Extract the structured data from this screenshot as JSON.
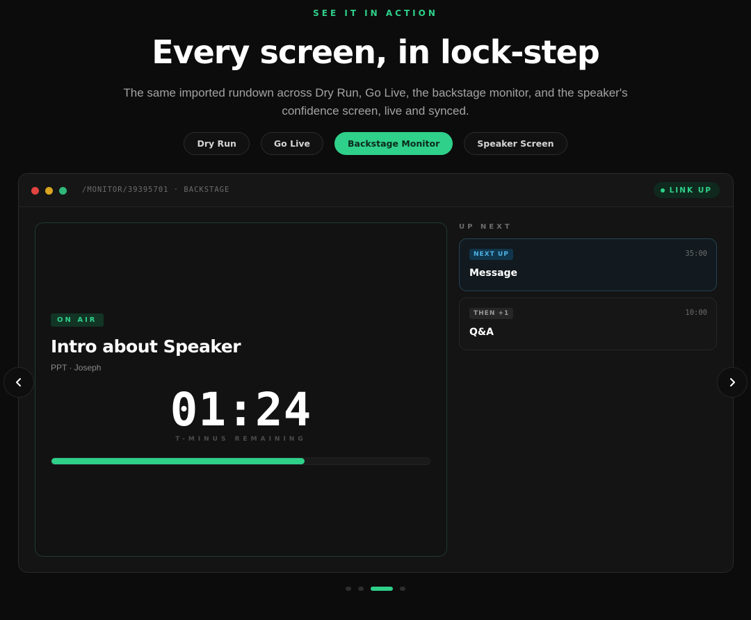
{
  "hero": {
    "eyebrow": "SEE IT IN ACTION",
    "title": "Every screen, in lock-step",
    "subtitle": "The same imported rundown across Dry Run, Go Live, the backstage monitor, and the speaker's confidence screen, live and synced."
  },
  "tabs": [
    {
      "label": "Dry Run",
      "active": false
    },
    {
      "label": "Go Live",
      "active": false
    },
    {
      "label": "Backstage Monitor",
      "active": true
    },
    {
      "label": "Speaker Screen",
      "active": false
    }
  ],
  "window": {
    "path": "/MONITOR/39395701 · BACKSTAGE",
    "status": "LINK UP",
    "current": {
      "badge": "ON AIR",
      "title": "Intro about Speaker",
      "meta": "PPT · Joseph",
      "countdown": "01:24",
      "countdown_label": "T-MINUS REMAINING",
      "progress": 0.67
    },
    "up_next": {
      "label": "UP NEXT",
      "items": [
        {
          "tag": "NEXT UP",
          "time": "35:00",
          "title": "Message"
        },
        {
          "tag": "THEN +1",
          "time": "10:00",
          "title": "Q&A"
        }
      ]
    }
  },
  "carousel": {
    "slides": 4,
    "active_index": 2,
    "prev_icon": "chevron-left-icon",
    "next_icon": "chevron-right-icon"
  },
  "colors": {
    "accent": "#2fd08a",
    "next_up": "#4fb3e4",
    "background": "#0c0c0c"
  }
}
